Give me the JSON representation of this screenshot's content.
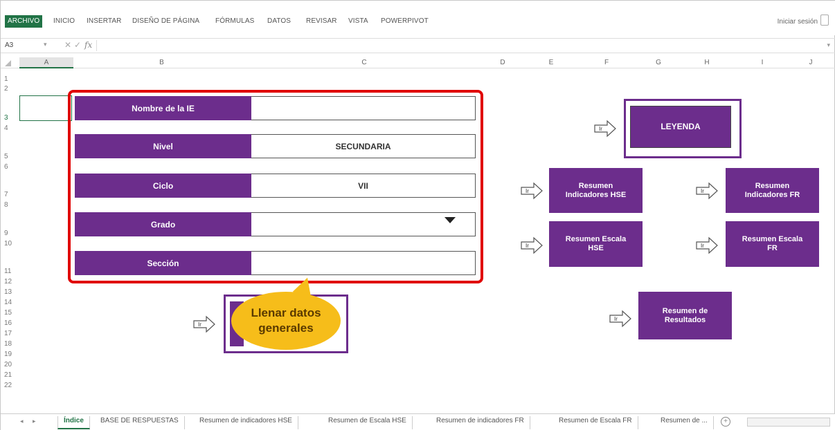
{
  "ribbon": {
    "tabs": [
      "ARCHIVO",
      "INICIO",
      "INSERTAR",
      "DISEÑO DE PÁGINA",
      "FÓRMULAS",
      "DATOS",
      "REVISAR",
      "VISTA",
      "POWERPIVOT"
    ],
    "signin": "Iniciar sesión"
  },
  "formula_bar": {
    "namebox": "A3",
    "fx": "fx"
  },
  "columns": [
    "A",
    "B",
    "C",
    "D",
    "E",
    "F",
    "G",
    "H",
    "I",
    "J"
  ],
  "rows": [
    "1",
    "2",
    "3",
    "4",
    "5",
    "6",
    "7",
    "8",
    "9",
    "10",
    "11",
    "12",
    "13",
    "14",
    "15",
    "16",
    "17",
    "18",
    "19",
    "20",
    "21",
    "22"
  ],
  "form": {
    "fields": [
      {
        "label": "Nombre de la IE",
        "value": ""
      },
      {
        "label": "Nivel",
        "value": "SECUNDARIA"
      },
      {
        "label": "Ciclo",
        "value": "VII"
      },
      {
        "label": "Grado",
        "value": ""
      },
      {
        "label": "Sección",
        "value": ""
      }
    ]
  },
  "ir_label": "Ir",
  "buttons": {
    "leyenda": "LEYENDA",
    "resumen_ind_hse": [
      "Resumen",
      "Indicadores HSE"
    ],
    "resumen_ind_fr": [
      "Resumen",
      "Indicadores FR"
    ],
    "resumen_esc_hse": [
      "Resumen Escala",
      "HSE"
    ],
    "resumen_esc_fr": [
      "Resumen Escala",
      "FR"
    ],
    "resumen_resultados": [
      "Resumen de",
      "Resultados"
    ]
  },
  "callout": [
    "Llenar datos",
    "generales"
  ],
  "sheet_tabs": [
    "Índice",
    "BASE DE RESPUESTAS",
    "Resumen de indicadores HSE",
    "Resumen de Escala HSE",
    "Resumen de indicadores FR",
    "Resumen de Escala FR",
    "Resumen de ..."
  ],
  "colors": {
    "purple": "#6c2d8c",
    "red_frame": "#e00000",
    "callout": "#f6bd1a",
    "excel_green": "#217346"
  }
}
